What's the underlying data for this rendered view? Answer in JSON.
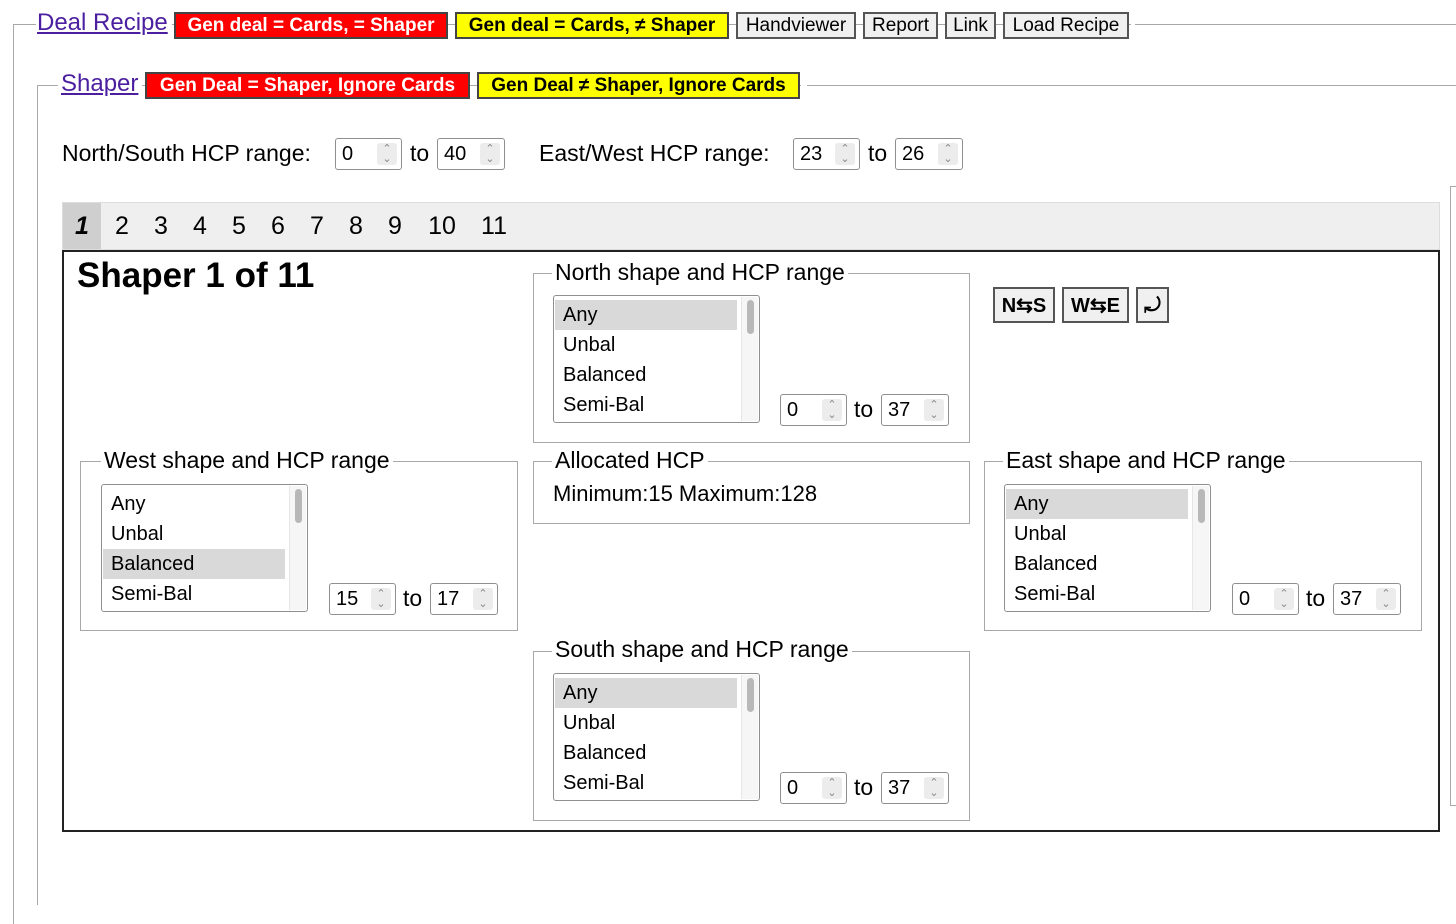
{
  "header": {
    "deal_recipe_link": "Deal Recipe",
    "buttons": {
      "gen_cards_eq_shaper": "Gen deal = Cards, = Shaper",
      "gen_cards_neq_shaper": "Gen deal = Cards, ≠ Shaper",
      "handviewer": "Handviewer",
      "report": "Report",
      "link": "Link",
      "load_recipe": "Load Recipe"
    }
  },
  "shaper": {
    "link": "Shaper",
    "buttons": {
      "gen_eq_shaper_ignore": "Gen Deal = Shaper, Ignore Cards",
      "gen_neq_shaper_ignore": "Gen Deal ≠ Shaper, Ignore Cards"
    },
    "ns_hcp_label": "North/South HCP range:",
    "ns_hcp_min": "0",
    "ns_hcp_max": "40",
    "ew_hcp_label": "East/West HCP range:",
    "ew_hcp_min": "23",
    "ew_hcp_max": "26",
    "to": "to",
    "tabs": [
      "1",
      "2",
      "3",
      "4",
      "5",
      "6",
      "7",
      "8",
      "9",
      "10",
      "11"
    ],
    "active_tab": "1"
  },
  "panel": {
    "title": "Shaper 1 of 11",
    "shape_options": [
      "Any",
      "Unbal",
      "Balanced",
      "Semi-Bal"
    ],
    "north": {
      "legend": "North shape and HCP range",
      "selected": "Any",
      "min": "0",
      "max": "37"
    },
    "west": {
      "legend": "West shape and HCP range",
      "selected": "Balanced",
      "min": "15",
      "max": "17"
    },
    "east": {
      "legend": "East shape and HCP range",
      "selected": "Any",
      "min": "0",
      "max": "37"
    },
    "south": {
      "legend": "South shape and HCP range",
      "selected": "Any",
      "min": "0",
      "max": "37"
    },
    "allocated": {
      "legend": "Allocated HCP",
      "text": "Minimum:15 Maximum:128"
    },
    "swap_ns": "N⇆S",
    "swap_we": "W⇆E",
    "rotate": "⤾"
  },
  "colors": {
    "red": "#ff0000",
    "yellow": "#ffff00",
    "link": "#4b1fa0"
  }
}
